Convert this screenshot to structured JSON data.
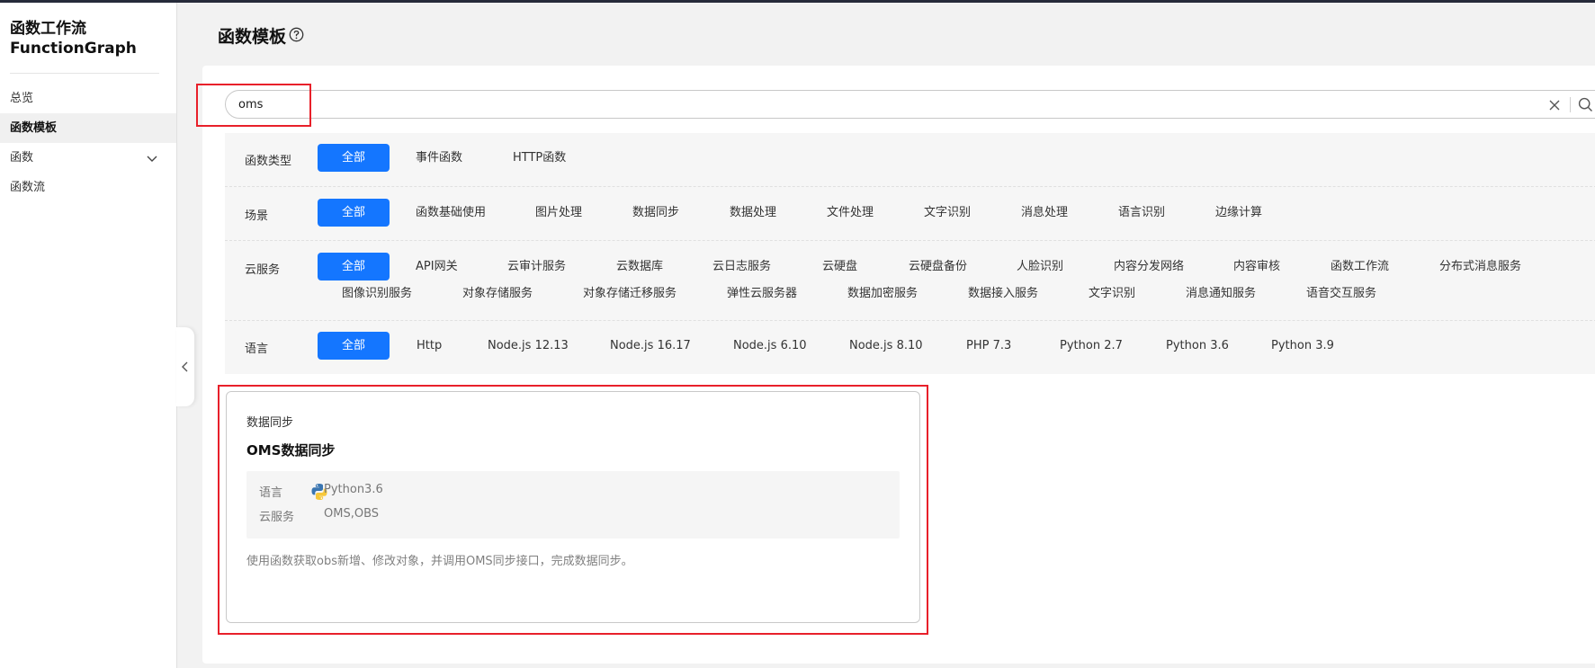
{
  "sidebar": {
    "brand_line1": "函数工作流",
    "brand_line2": "FunctionGraph",
    "items": [
      {
        "label": "总览"
      },
      {
        "label": "函数模板"
      },
      {
        "label": "函数"
      },
      {
        "label": "函数流"
      }
    ]
  },
  "page": {
    "title": "函数模板"
  },
  "search": {
    "value": "oms"
  },
  "filters": {
    "function_type": {
      "label": "函数类型",
      "options": [
        "全部",
        "事件函数",
        "HTTP函数"
      ]
    },
    "scene": {
      "label": "场景",
      "options": [
        "全部",
        "函数基础使用",
        "图片处理",
        "数据同步",
        "数据处理",
        "文件处理",
        "文字识别",
        "消息处理",
        "语言识别",
        "边缘计算"
      ]
    },
    "cloud_service": {
      "label": "云服务",
      "options": [
        "全部",
        "API网关",
        "云审计服务",
        "云数据库",
        "云日志服务",
        "云硬盘",
        "云硬盘备份",
        "人脸识别",
        "内容分发网络",
        "内容审核",
        "函数工作流",
        "分布式消息服务",
        "图像识别服务",
        "对象存储服务",
        "对象存储迁移服务",
        "弹性云服务器",
        "数据加密服务",
        "数据接入服务",
        "文字识别",
        "消息通知服务",
        "语音交互服务"
      ]
    },
    "language": {
      "label": "语言",
      "options": [
        "全部",
        "Http",
        "Node.js 12.13",
        "Node.js 16.17",
        "Node.js 6.10",
        "Node.js 8.10",
        "PHP 7.3",
        "Python 2.7",
        "Python 3.6",
        "Python 3.9"
      ]
    }
  },
  "template": {
    "category": "数据同步",
    "title": "OMS数据同步",
    "language_label": "语言",
    "language_value": "Python3.6",
    "cloud_label": "云服务",
    "cloud_value": "OMS,OBS",
    "description": "使用函数获取obs新增、修改对象，并调用OMS同步接口，完成数据同步。"
  },
  "colors": {
    "accent": "#1476ff",
    "highlight": "#e8202a",
    "panel": "#f6f6f6"
  }
}
